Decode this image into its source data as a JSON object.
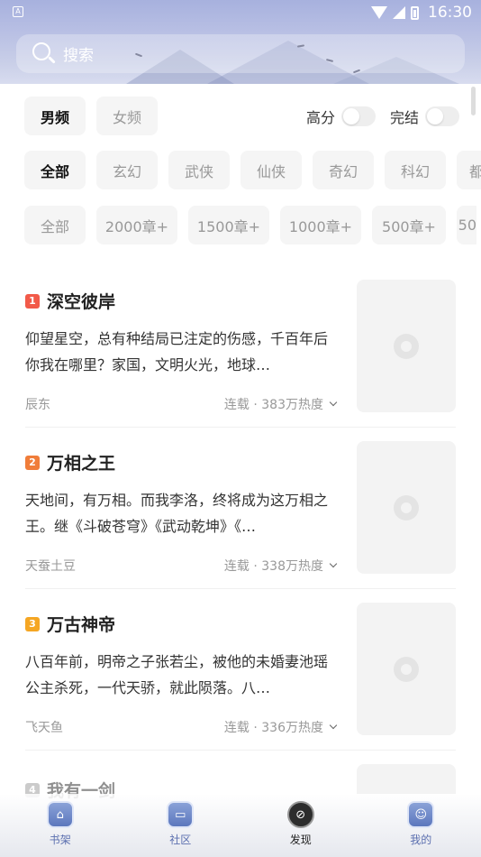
{
  "status": {
    "time": "16:30",
    "left_icon": "A"
  },
  "search": {
    "placeholder": "搜索"
  },
  "channels": [
    "男频",
    "女频"
  ],
  "toggles": {
    "high_score": "高分",
    "completed": "完结"
  },
  "genres": [
    "全部",
    "玄幻",
    "武侠",
    "仙侠",
    "奇幻",
    "科幻",
    "都"
  ],
  "lengths": [
    "全部",
    "2000章+",
    "1500章+",
    "1000章+",
    "500章+",
    "50"
  ],
  "books": [
    {
      "rank": "1",
      "rank_color": "#f25a49",
      "title": "深空彼岸",
      "desc": "仰望星空，总有种结局已注定的伤感，千百年后你我在哪里？家国，文明火光，地球…",
      "author": "辰东",
      "stat": "连载 · 383万热度"
    },
    {
      "rank": "2",
      "rank_color": "#f07d3a",
      "title": "万相之王",
      "desc": "天地间，有万相。而我李洛，终将成为这万相之王。继《斗破苍穹》《武动乾坤》《…",
      "author": "天蚕土豆",
      "stat": "连载 · 338万热度"
    },
    {
      "rank": "3",
      "rank_color": "#f5a623",
      "title": "万古神帝",
      "desc": "八百年前，明帝之子张若尘，被他的未婚妻池瑶公主杀死，一代天骄，就此陨落。八…",
      "author": "飞天鱼",
      "stat": "连载 · 336万热度"
    },
    {
      "rank": "4",
      "rank_color": "#999999",
      "title": "我有一剑",
      "desc": "",
      "author": "",
      "stat": ""
    }
  ],
  "nav": [
    {
      "label": "书架",
      "icon": "bookshelf-icon"
    },
    {
      "label": "社区",
      "icon": "community-icon"
    },
    {
      "label": "发现",
      "icon": "compass-icon"
    },
    {
      "label": "我的",
      "icon": "profile-icon"
    }
  ]
}
